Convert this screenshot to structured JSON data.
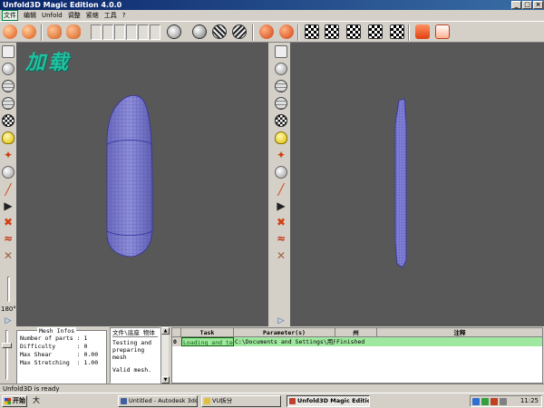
{
  "window": {
    "title": "Unfold3D Magic Edition 4.0.0",
    "controls": [
      "_",
      "□",
      "×"
    ]
  },
  "menu": [
    "文件",
    "编辑",
    "Unfold",
    "调整",
    "紧缩",
    "工具",
    "?"
  ],
  "overlay_text": "加载",
  "side_slider": {
    "value": "180°"
  },
  "mesh_info": {
    "title": "Mesh Infos",
    "rows": [
      {
        "label": "Number of parts",
        "value": "1"
      },
      {
        "label": "Difficulty",
        "value": "0"
      },
      {
        "label": "Max Shear",
        "value": "0.00"
      },
      {
        "label": "Max Stretching",
        "value": "1.00"
      }
    ]
  },
  "log": {
    "header": "文件\\底座 物体",
    "lines": [
      "Testing and",
      "preparing mesh",
      "",
      "Valid mesh."
    ]
  },
  "tasks": {
    "columns": [
      "",
      "Task",
      "Parameter(s)",
      "州",
      "注释"
    ],
    "rows": [
      {
        "index": "0",
        "task": "Loading and test",
        "parameters": "C:\\Documents and Settings\\用户\\M",
        "state": "Finished",
        "note": ""
      }
    ]
  },
  "status": "Unfold3D is ready",
  "taskbar": {
    "start_label": "开始",
    "quick_launch": "大",
    "buttons": [
      {
        "label": "Untitled - Autodesk 3ds ...",
        "active": false
      },
      {
        "label": "VU拆分",
        "active": false
      },
      {
        "label": "Unfold3D Magic Edition 4...",
        "active": true
      }
    ],
    "clock": "11:25"
  },
  "colors": {
    "titlebar": "#0a246a",
    "viewport": "#585858",
    "mesh_wire": "#4040c0",
    "task_row": "#a0e8a0",
    "overlay": "#20c0a0"
  }
}
